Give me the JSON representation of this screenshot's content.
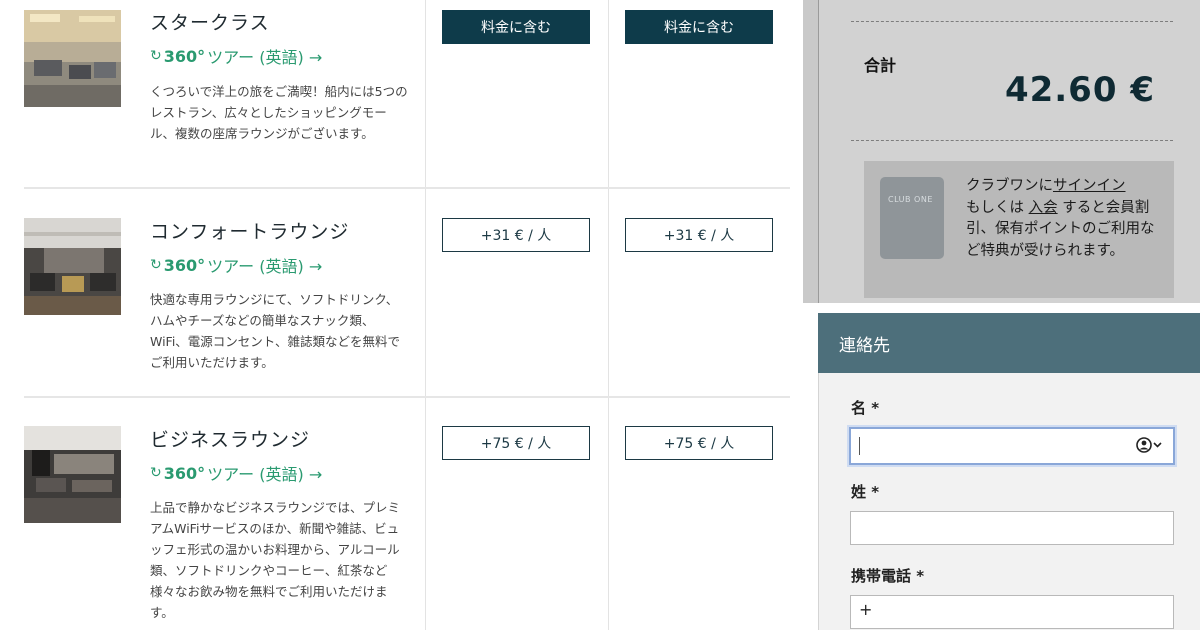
{
  "tiers": [
    {
      "title": "スタークラス",
      "tour_num": "360°",
      "tour_label": "ツアー (英語) →",
      "description": "くつろいで洋上の旅をご満喫！船内には5つのレストラン、広々としたショッピングモール、複数の座席ラウンジがございます。",
      "price_1": "料金に含む",
      "price_2": "料金に含む"
    },
    {
      "title": "コンフォートラウンジ",
      "tour_num": "360°",
      "tour_label": "ツアー (英語) →",
      "description": "快適な専用ラウンジにて、ソフトドリンク、ハムやチーズなどの簡単なスナック類、WiFi、電源コンセント、雑誌類などを無料でご利用いただけます。",
      "price_1": "+31 € / 人",
      "price_2": "+31 € / 人"
    },
    {
      "title": "ビジネスラウンジ",
      "tour_num": "360°",
      "tour_label": "ツアー (英語) →",
      "description": "上品で静かなビジネスラウンジでは、プレミアムWiFiサービスのほか、新聞や雑誌、ビュッフェ形式の温かいお料理から、アルコール類、ソフトドリンクやコーヒー、紅茶など様々なお飲み物を無料でご利用いただけます。",
      "price_1": "+75 € / 人",
      "price_2": "+75 € / 人"
    }
  ],
  "summary": {
    "total_label": "合計",
    "total_value": "42.60 €",
    "card_text": "CLUB ONE",
    "club_pre": "クラブワンに",
    "club_signin": "サインイン",
    "club_mid": "もしくは ",
    "club_join": "入会",
    "club_post": " すると会員割引、保有ポイントのご利用など特典が受けられます。"
  },
  "contact": {
    "header": "連絡先",
    "first_name_label": "名 *",
    "last_name_label": "姓 *",
    "phone_label": "携帯電話 *",
    "phone_prefix": "+"
  },
  "colors": {
    "accent_dark": "#0e3b4a",
    "tour_green": "#2a9a70",
    "contact_header": "#4d6f7b"
  }
}
